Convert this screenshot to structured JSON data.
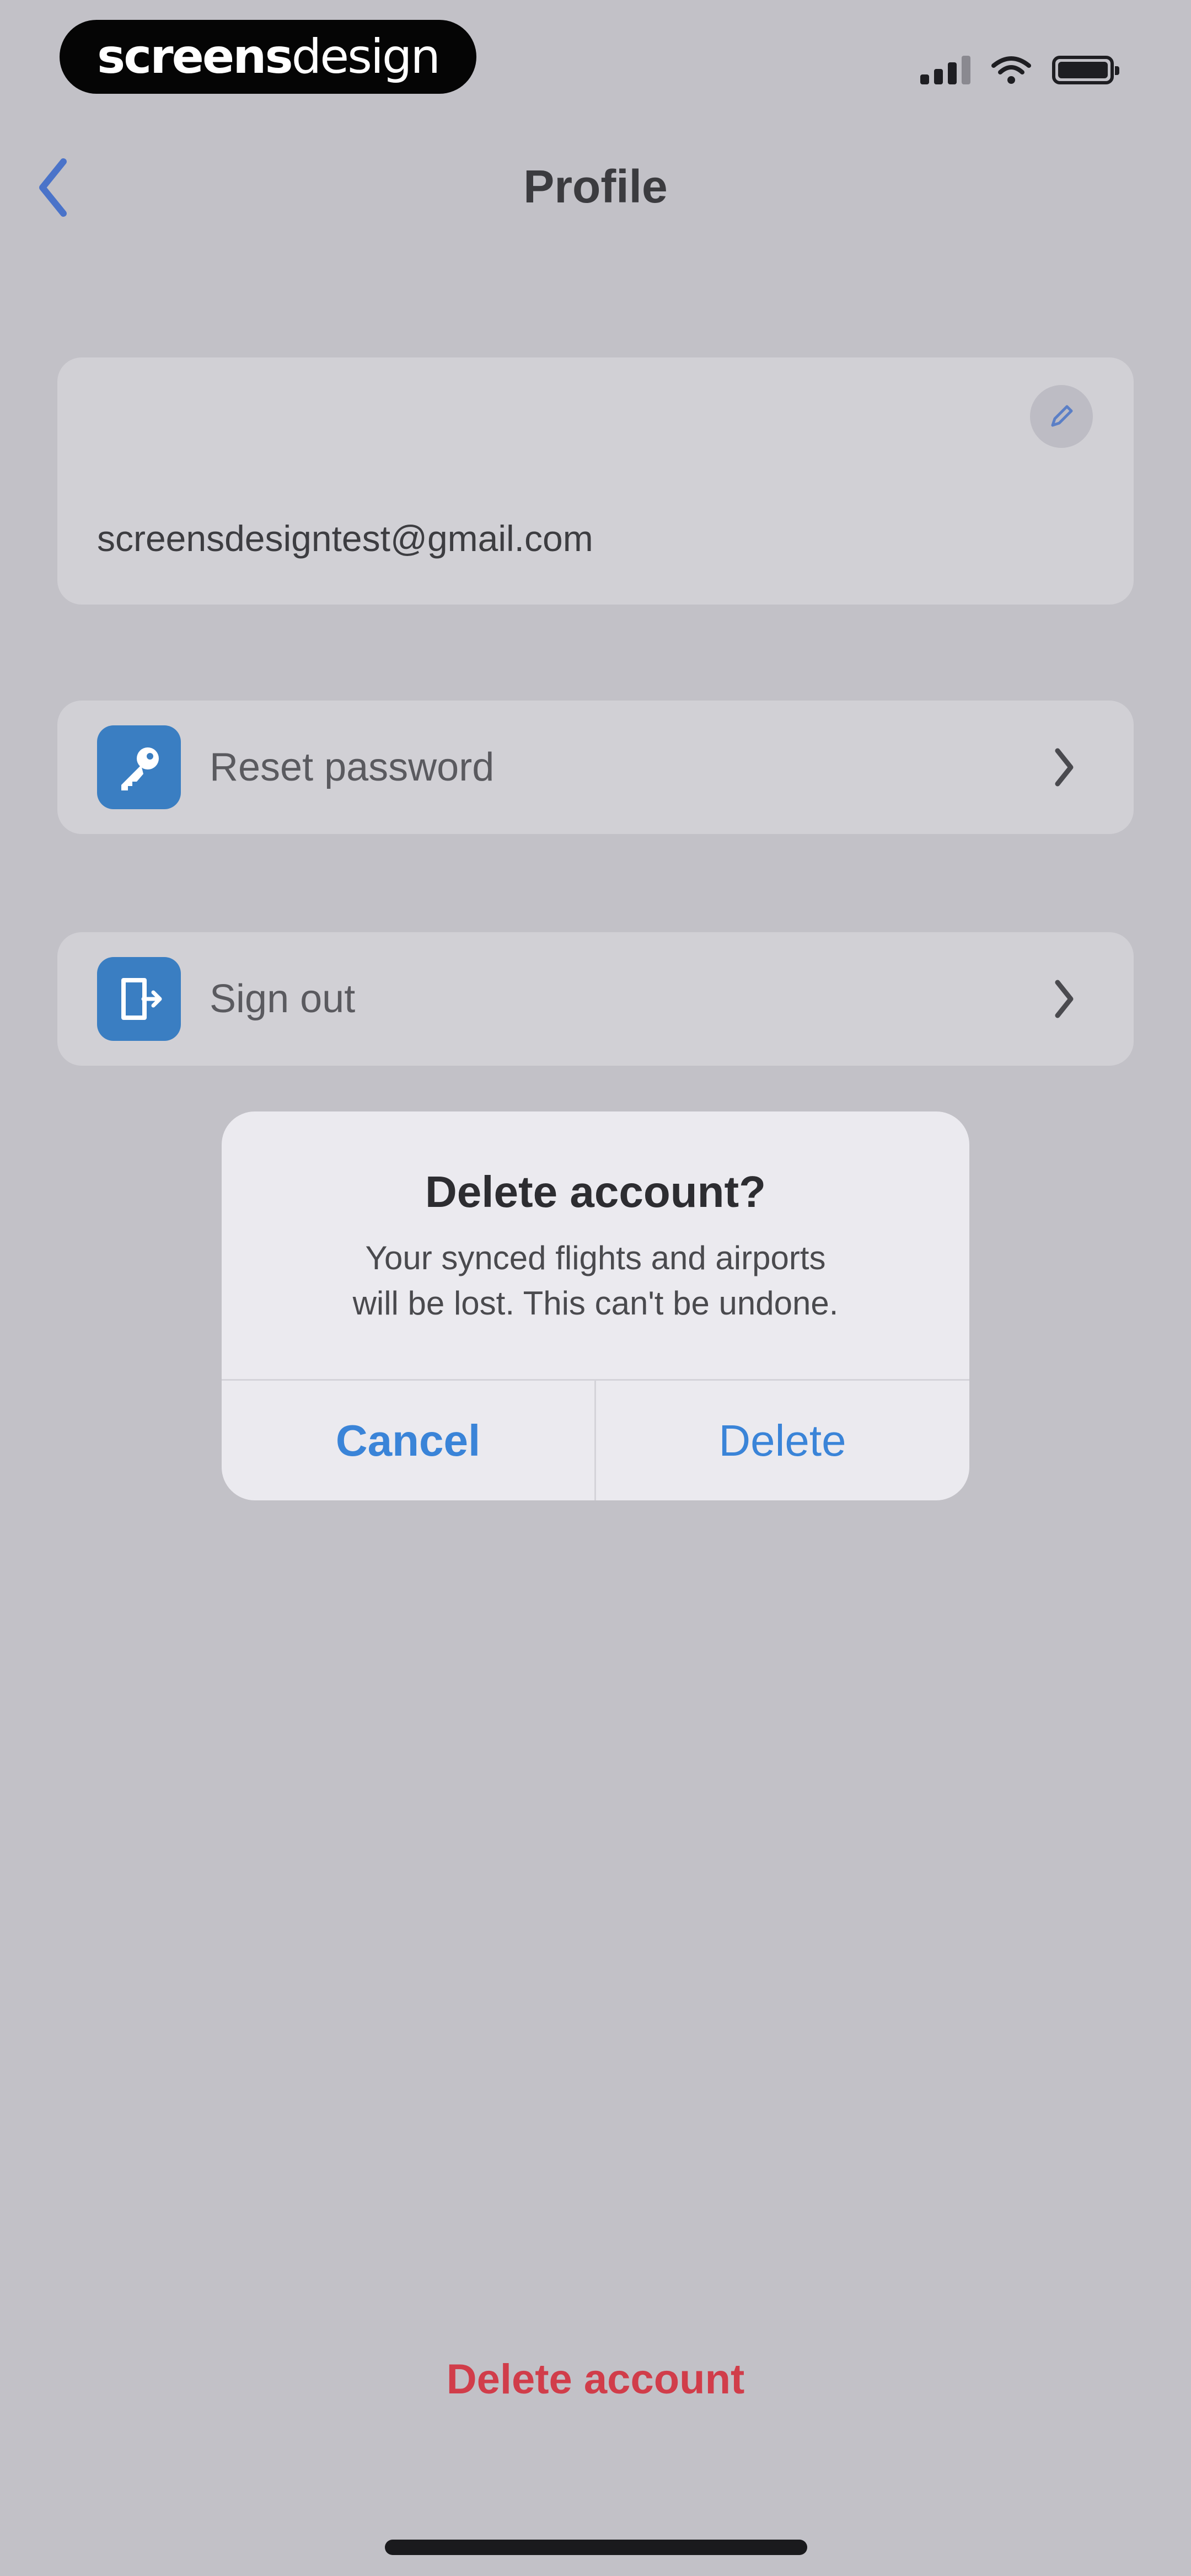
{
  "status_bar": {
    "brand_bold": "screens",
    "brand_light": "design"
  },
  "nav": {
    "title": "Profile"
  },
  "profile": {
    "email": "screensdesigntest@gmail.com"
  },
  "menu": {
    "reset_password": "Reset password",
    "sign_out": "Sign out"
  },
  "alert": {
    "title": "Delete account?",
    "message_line1": "Your synced flights and airports",
    "message_line2": "will be lost. This can't be undone.",
    "cancel": "Cancel",
    "delete": "Delete"
  },
  "footer": {
    "delete_account": "Delete account"
  },
  "colors": {
    "accent": "#3a84d8",
    "destructive": "#d13d4a",
    "icon_bg": "#3a7ec2"
  },
  "icons": {
    "back": "chevron-left-icon",
    "edit": "pencil-icon",
    "reset": "key-icon",
    "signout": "door-exit-icon",
    "row_chevron": "chevron-right-icon"
  }
}
